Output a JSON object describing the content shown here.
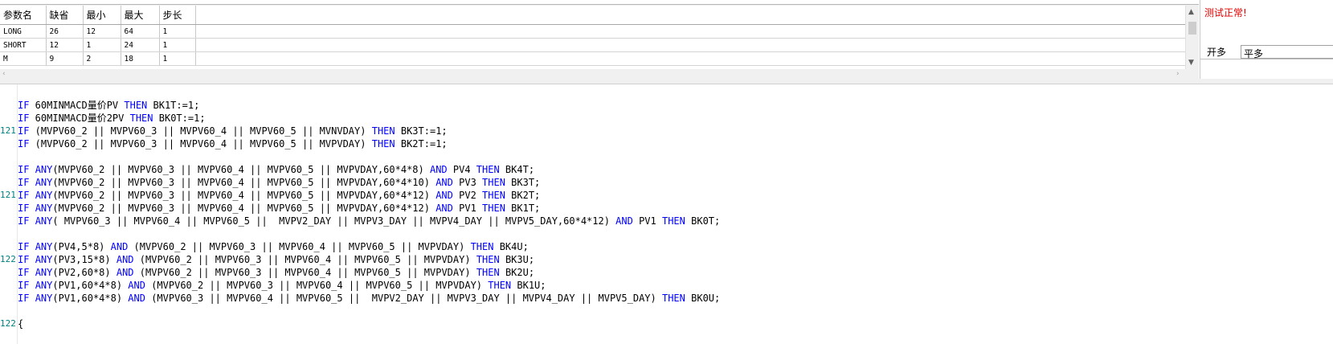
{
  "param_grid": {
    "headers": [
      "参数名",
      "缺省",
      "最小",
      "最大",
      "步长"
    ],
    "rows": [
      [
        "LONG",
        "26",
        "12",
        "64",
        "1"
      ],
      [
        "SHORT",
        "12",
        "1",
        "24",
        "1"
      ],
      [
        "M",
        "9",
        "2",
        "18",
        "1"
      ]
    ]
  },
  "right_panel": {
    "status_text": "测试正常!",
    "tab_1_label": "开多",
    "tab_2_label": "平多"
  },
  "editor": {
    "lines": [
      {
        "ln": "",
        "segs": [
          [
            "kw",
            "IF"
          ],
          [
            "t",
            " 60MINMACD量价PV "
          ],
          [
            "kw",
            "THEN"
          ],
          [
            "t",
            " BK1T:=1;"
          ]
        ]
      },
      {
        "ln": "",
        "segs": [
          [
            "kw",
            "IF"
          ],
          [
            "t",
            " 60MINMACD量价2PV "
          ],
          [
            "kw",
            "THEN"
          ],
          [
            "t",
            " BK0T:=1;"
          ]
        ]
      },
      {
        "ln": "121",
        "segs": [
          [
            "kw",
            "IF"
          ],
          [
            "t",
            " (MVPV60_2 || MVPV60_3 || MVPV60_4 || MVPV60_5 || MVNVDAY) "
          ],
          [
            "kw",
            "THEN"
          ],
          [
            "t",
            " BK3T:=1;"
          ]
        ]
      },
      {
        "ln": "",
        "segs": [
          [
            "kw",
            "IF"
          ],
          [
            "t",
            " (MVPV60_2 || MVPV60_3 || MVPV60_4 || MVPV60_5 || MVPVDAY) "
          ],
          [
            "kw",
            "THEN"
          ],
          [
            "t",
            " BK2T:=1;"
          ]
        ]
      },
      {
        "ln": "",
        "segs": []
      },
      {
        "ln": "",
        "segs": [
          [
            "kw",
            "IF"
          ],
          [
            "t",
            " "
          ],
          [
            "kw",
            "ANY"
          ],
          [
            "t",
            "(MVPV60_2 || MVPV60_3 || MVPV60_4 || MVPV60_5 || MVPVDAY,60*4*8) "
          ],
          [
            "kw",
            "AND"
          ],
          [
            "t",
            " PV4 "
          ],
          [
            "kw",
            "THEN"
          ],
          [
            "t",
            " BK4T;"
          ]
        ]
      },
      {
        "ln": "",
        "segs": [
          [
            "kw",
            "IF"
          ],
          [
            "t",
            " "
          ],
          [
            "kw",
            "ANY"
          ],
          [
            "t",
            "(MVPV60_2 || MVPV60_3 || MVPV60_4 || MVPV60_5 || MVPVDAY,60*4*10) "
          ],
          [
            "kw",
            "AND"
          ],
          [
            "t",
            " PV3 "
          ],
          [
            "kw",
            "THEN"
          ],
          [
            "t",
            " BK3T;"
          ]
        ]
      },
      {
        "ln": "121",
        "segs": [
          [
            "kw",
            "IF"
          ],
          [
            "t",
            " "
          ],
          [
            "kw",
            "ANY"
          ],
          [
            "t",
            "(MVPV60_2 || MVPV60_3 || MVPV60_4 || MVPV60_5 || MVPVDAY,60*4*12) "
          ],
          [
            "kw",
            "AND"
          ],
          [
            "t",
            " PV2 "
          ],
          [
            "kw",
            "THEN"
          ],
          [
            "t",
            " BK2T;"
          ]
        ]
      },
      {
        "ln": "",
        "segs": [
          [
            "kw",
            "IF"
          ],
          [
            "t",
            " "
          ],
          [
            "kw",
            "ANY"
          ],
          [
            "t",
            "(MVPV60_2 || MVPV60_3 || MVPV60_4 || MVPV60_5 || MVPVDAY,60*4*12) "
          ],
          [
            "kw",
            "AND"
          ],
          [
            "t",
            " PV1 "
          ],
          [
            "kw",
            "THEN"
          ],
          [
            "t",
            " BK1T;"
          ]
        ]
      },
      {
        "ln": "",
        "segs": [
          [
            "kw",
            "IF"
          ],
          [
            "t",
            " "
          ],
          [
            "kw",
            "ANY"
          ],
          [
            "t",
            "( MVPV60_3 || MVPV60_4 || MVPV60_5 ||  MVPV2_DAY || MVPV3_DAY || MVPV4_DAY || MVPV5_DAY,60*4*12) "
          ],
          [
            "kw",
            "AND"
          ],
          [
            "t",
            " PV1 "
          ],
          [
            "kw",
            "THEN"
          ],
          [
            "t",
            " BK0T;"
          ]
        ]
      },
      {
        "ln": "",
        "segs": []
      },
      {
        "ln": "",
        "segs": [
          [
            "kw",
            "IF"
          ],
          [
            "t",
            " "
          ],
          [
            "kw",
            "ANY"
          ],
          [
            "t",
            "(PV4,5*8) "
          ],
          [
            "kw",
            "AND"
          ],
          [
            "t",
            " (MVPV60_2 || MVPV60_3 || MVPV60_4 || MVPV60_5 || MVPVDAY) "
          ],
          [
            "kw",
            "THEN"
          ],
          [
            "t",
            " BK4U;"
          ]
        ]
      },
      {
        "ln": "122",
        "segs": [
          [
            "kw",
            "IF"
          ],
          [
            "t",
            " "
          ],
          [
            "kw",
            "ANY"
          ],
          [
            "t",
            "(PV3,15*8) "
          ],
          [
            "kw",
            "AND"
          ],
          [
            "t",
            " (MVPV60_2 || MVPV60_3 || MVPV60_4 || MVPV60_5 || MVPVDAY) "
          ],
          [
            "kw",
            "THEN"
          ],
          [
            "t",
            " BK3U;"
          ]
        ]
      },
      {
        "ln": "",
        "segs": [
          [
            "kw",
            "IF"
          ],
          [
            "t",
            " "
          ],
          [
            "kw",
            "ANY"
          ],
          [
            "t",
            "(PV2,60*8) "
          ],
          [
            "kw",
            "AND"
          ],
          [
            "t",
            " (MVPV60_2 || MVPV60_3 || MVPV60_4 || MVPV60_5 || MVPVDAY) "
          ],
          [
            "kw",
            "THEN"
          ],
          [
            "t",
            " BK2U;"
          ]
        ]
      },
      {
        "ln": "",
        "segs": [
          [
            "kw",
            "IF"
          ],
          [
            "t",
            " "
          ],
          [
            "kw",
            "ANY"
          ],
          [
            "t",
            "(PV1,60*4*8) "
          ],
          [
            "kw",
            "AND"
          ],
          [
            "t",
            " (MVPV60_2 || MVPV60_3 || MVPV60_4 || MVPV60_5 || MVPVDAY) "
          ],
          [
            "kw",
            "THEN"
          ],
          [
            "t",
            " BK1U;"
          ]
        ]
      },
      {
        "ln": "",
        "segs": [
          [
            "kw",
            "IF"
          ],
          [
            "t",
            " "
          ],
          [
            "kw",
            "ANY"
          ],
          [
            "t",
            "(PV1,60*4*8) "
          ],
          [
            "kw",
            "AND"
          ],
          [
            "t",
            " (MVPV60_3 || MVPV60_4 || MVPV60_5 ||  MVPV2_DAY || MVPV3_DAY || MVPV4_DAY || MVPV5_DAY) "
          ],
          [
            "kw",
            "THEN"
          ],
          [
            "t",
            " BK0U;"
          ]
        ]
      },
      {
        "ln": "",
        "segs": []
      },
      {
        "ln": "122",
        "segs": [
          [
            "t",
            "{"
          ]
        ]
      }
    ]
  },
  "icons": {
    "scroll_up": "scroll-up-arrow-icon",
    "scroll_down": "scroll-down-arrow-icon",
    "scroll_left": "scroll-left-arrow-icon",
    "scroll_right": "scroll-right-arrow-icon"
  },
  "colors": {
    "keyword": "#0000ff",
    "line_number": "#008080",
    "status_text": "#e00000"
  }
}
